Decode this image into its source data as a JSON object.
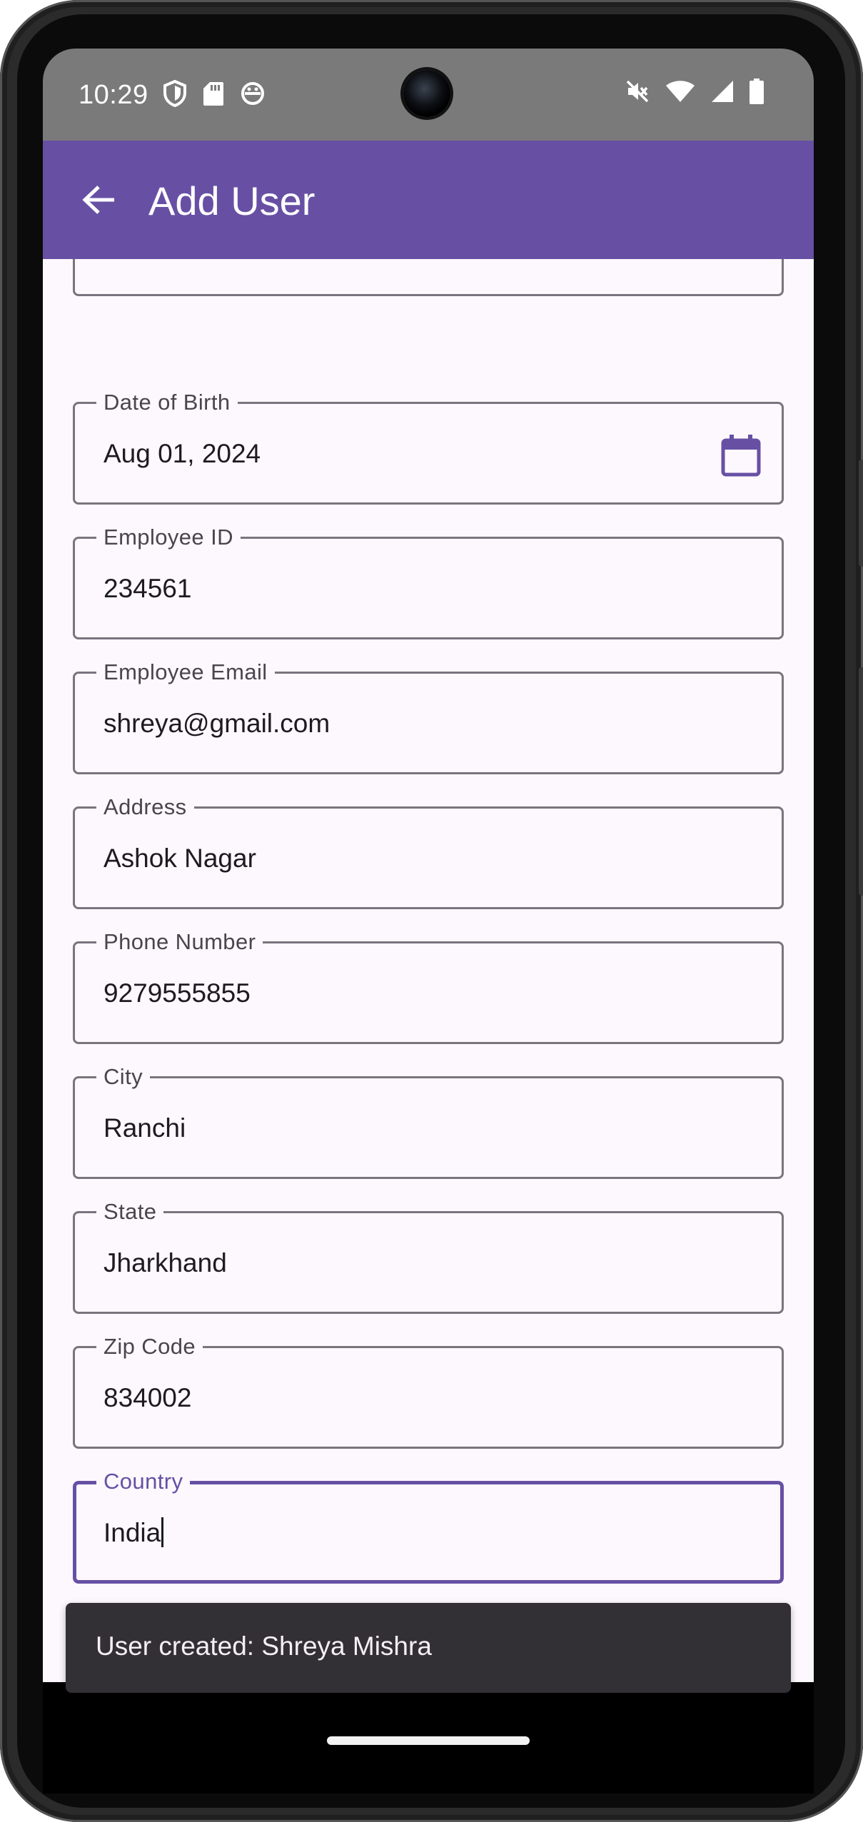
{
  "status_bar": {
    "time": "10:29",
    "left_icons": [
      "shield-icon",
      "sd-card-icon",
      "game-controller-icon"
    ],
    "right_icons": [
      "mute-icon",
      "wifi-icon",
      "signal-icon",
      "battery-icon"
    ]
  },
  "app_bar": {
    "title": "Add User",
    "back_icon": "arrow-back-icon",
    "color": "#6750a4"
  },
  "form": {
    "fields": [
      {
        "id": "dob",
        "label": "Date of Birth",
        "value": "Aug 01, 2024",
        "trailing_icon": "calendar-icon"
      },
      {
        "id": "employee_id",
        "label": "Employee ID",
        "value": "234561"
      },
      {
        "id": "employee_email",
        "label": "Employee Email",
        "value": "shreya@gmail.com"
      },
      {
        "id": "address",
        "label": "Address",
        "value": "Ashok Nagar"
      },
      {
        "id": "phone",
        "label": "Phone Number",
        "value": "9279555855"
      },
      {
        "id": "city",
        "label": "City",
        "value": "Ranchi"
      },
      {
        "id": "state",
        "label": "State",
        "value": "Jharkhand"
      },
      {
        "id": "zip",
        "label": "Zip Code",
        "value": "834002"
      },
      {
        "id": "country",
        "label": "Country",
        "value": "India",
        "focused": true
      }
    ]
  },
  "snackbar": {
    "message": "User created: Shreya Mishra"
  },
  "colors": {
    "primary": "#6750a4",
    "surface": "#fdf8fd",
    "outline": "#79747e",
    "snackbar": "#322f35"
  }
}
